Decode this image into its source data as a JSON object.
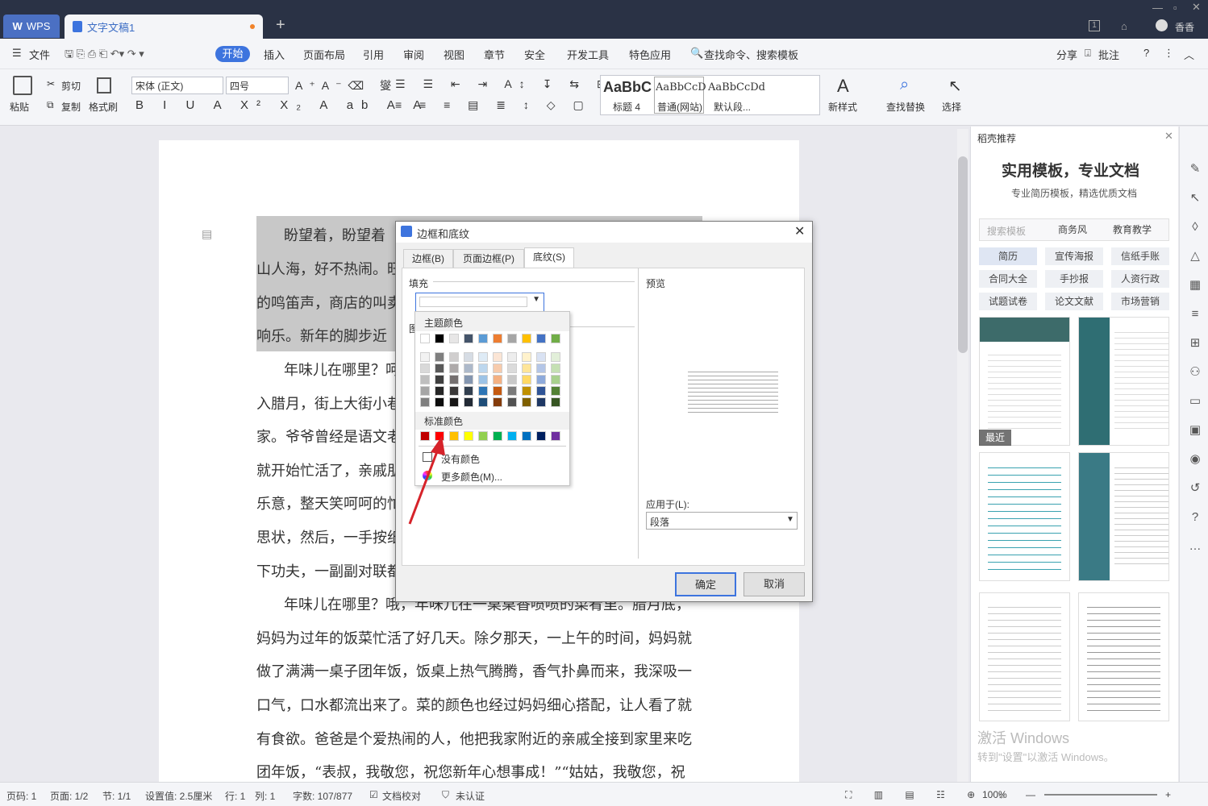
{
  "titlebar": {
    "wps_label": "WPS",
    "doc_tab": "文字文稿1",
    "new_tab": "+",
    "account": "香香"
  },
  "menu": {
    "file": "文件",
    "start": "开始",
    "items": [
      "插入",
      "页面布局",
      "引用",
      "审阅",
      "视图",
      "章节",
      "安全",
      "开发工具",
      "特色应用"
    ],
    "search": "查找命令、搜索模板",
    "share": "分享",
    "comment": "批注",
    "help": "?"
  },
  "ribbon": {
    "paste": "粘贴",
    "cut": "剪切",
    "copy": "复制",
    "format_painter": "格式刷",
    "font_name": "宋体 (正文)",
    "font_size": "四号",
    "styles": [
      {
        "preview": "AaBbC",
        "name": "标题 4"
      },
      {
        "preview": "AaBbCcD",
        "name": "普通(网站)"
      },
      {
        "preview": "AaBbCcDd",
        "name": "默认段..."
      }
    ],
    "new_style": "新样式",
    "find_replace": "查找替换",
    "select": "选择"
  },
  "document": {
    "lines": [
      "盼望着，盼望着",
      "山人海，好不热闹。旺",
      "的鸣笛声，商店的叫卖",
      "响乐。新年的脚步近",
      "年味儿在哪里？呵",
      "入腊月，街上大街小巷",
      "家。爷爷曾经是语文老",
      "就开始忙活了，亲戚朋",
      "乐意，整天笑呵呵的忙",
      "思状，然后，一手按纸",
      "下功夫，一副副对联都",
      "年味儿在哪里？哦，年味儿在一桌桌香喷喷的菜肴里。腊月底，",
      "妈妈为过年的饭菜忙活了好几天。除夕那天，一上午的时间，妈妈就",
      "做了满满一桌子团年饭，饭桌上热气腾腾，香气扑鼻而来，我深吸一",
      "口气，口水都流出来了。菜的颜色也经过妈妈细心搭配，让人看了就",
      "有食欲。爸爸是个爱热闹的人，他把我家附近的亲戚全接到家里来吃",
      "团年饭，“表叔，我敬您，祝您新年心想事成！”“姑姑，我敬您，祝"
    ]
  },
  "dialog": {
    "title": "边框和底纹",
    "tabs": [
      "边框(B)",
      "页面边框(P)",
      "底纹(S)"
    ],
    "fill_label": "填充",
    "pattern_label": "图",
    "preview_label": "预览",
    "apply_label": "应用于(L):",
    "apply_value": "段落",
    "ok": "确定",
    "cancel": "取消"
  },
  "color_popup": {
    "theme_label": "主题颜色",
    "standard_label": "标准颜色",
    "no_color": "没有颜色",
    "more_colors": "更多颜色(M)...",
    "theme_row": [
      "#ffffff",
      "#000000",
      "#e7e6e6",
      "#44546a",
      "#5b9bd5",
      "#ed7d31",
      "#a5a5a5",
      "#ffc000",
      "#4472c4",
      "#70ad47"
    ],
    "shade_cols": [
      [
        "#f2f2f2",
        "#d9d9d9",
        "#bfbfbf",
        "#a6a6a6",
        "#808080"
      ],
      [
        "#7f7f7f",
        "#595959",
        "#3f3f3f",
        "#262626",
        "#0d0d0d"
      ],
      [
        "#d0cece",
        "#aeaaaa",
        "#757070",
        "#3a3838",
        "#171616"
      ],
      [
        "#d6dce4",
        "#adb9ca",
        "#8496b0",
        "#323f4f",
        "#222a35"
      ],
      [
        "#deebf6",
        "#bdd7ee",
        "#9dc3e6",
        "#2e75b5",
        "#1f4e79"
      ],
      [
        "#fbe5d5",
        "#f7cbac",
        "#f4b183",
        "#c55a11",
        "#843c0b"
      ],
      [
        "#ededed",
        "#dbdbdb",
        "#c9c9c9",
        "#7b7b7b",
        "#525252"
      ],
      [
        "#fff2cc",
        "#fee599",
        "#ffd965",
        "#bf9000",
        "#7f6000"
      ],
      [
        "#d9e2f3",
        "#b4c6e7",
        "#8eaadb",
        "#2f5496",
        "#1f3864"
      ],
      [
        "#e2efd9",
        "#c5e0b3",
        "#a8d08d",
        "#538135",
        "#375623"
      ]
    ],
    "standard_row": [
      "#c00000",
      "#ff0000",
      "#ffc000",
      "#ffff00",
      "#92d050",
      "#00b050",
      "#00b0f0",
      "#0070c0",
      "#002060",
      "#7030a0"
    ]
  },
  "pane": {
    "title": "稻壳推荐",
    "headline": "实用模板，专业文档",
    "subtitle": "专业简历模板，精选优质文档",
    "search_placeholder": "搜索模板",
    "tags": [
      "商务风",
      "教育教学",
      "简历",
      "宣传海报",
      "信纸手账",
      "合同大全",
      "手抄报",
      "人资行政",
      "试题试卷",
      "论文文献",
      "市场营销"
    ],
    "recent": "最近",
    "watermark1": "激活 Windows",
    "watermark2": "转到\"设置\"以激活 Windows。"
  },
  "status": {
    "page": "页码: 1",
    "pages": "页面: 1/2",
    "section": "节: 1/1",
    "setting": "设置值: 2.5厘米",
    "row": "行: 1",
    "col": "列: 1",
    "words": "字数: 107/877",
    "proof": "文档校对",
    "auth": "未认证",
    "zoom": "100%"
  }
}
